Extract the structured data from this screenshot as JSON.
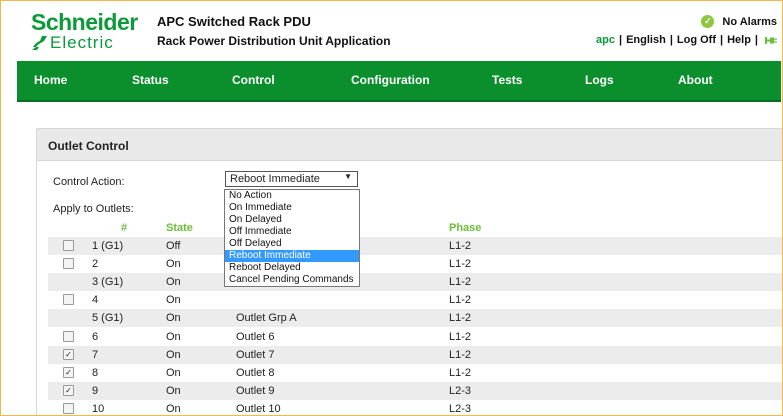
{
  "header": {
    "logo_top": "Schneider",
    "logo_bottom": "Electric",
    "title": "APC Switched Rack PDU",
    "subtitle": "Rack Power Distribution Unit Application",
    "alarm_status": "No Alarms",
    "user": "apc",
    "links": [
      "English",
      "Log Off",
      "Help"
    ],
    "separator": "|"
  },
  "nav": [
    "Home",
    "Status",
    "Control",
    "Configuration",
    "Tests",
    "Logs",
    "About"
  ],
  "panel": {
    "title": "Outlet Control",
    "control_action_label": "Control Action:",
    "apply_label": "Apply to Outlets:",
    "selected_action": "Reboot Immediate",
    "arrow": "▼"
  },
  "dropdown": {
    "options": [
      "No Action",
      "On Immediate",
      "On Delayed",
      "Off Immediate",
      "Off Delayed",
      "Reboot Immediate",
      "Reboot Delayed",
      "Cancel Pending Commands"
    ],
    "selected_index": 5
  },
  "table": {
    "headers": [
      "#",
      "State",
      "Phase"
    ],
    "rows": [
      {
        "num": "1 (G1)",
        "state": "Off",
        "name": "",
        "phase": "L1-2",
        "checkbox": true,
        "checked": false
      },
      {
        "num": "2",
        "state": "On",
        "name": "",
        "phase": "L1-2",
        "checkbox": true,
        "checked": false
      },
      {
        "num": "3 (G1)",
        "state": "On",
        "name": "",
        "phase": "L1-2",
        "checkbox": false,
        "checked": false
      },
      {
        "num": "4",
        "state": "On",
        "name": "",
        "phase": "L1-2",
        "checkbox": true,
        "checked": false
      },
      {
        "num": "5 (G1)",
        "state": "On",
        "name": "Outlet Grp A",
        "phase": "L1-2",
        "checkbox": false,
        "checked": false
      },
      {
        "num": "6",
        "state": "On",
        "name": "Outlet 6",
        "phase": "L1-2",
        "checkbox": true,
        "checked": false
      },
      {
        "num": "7",
        "state": "On",
        "name": "Outlet 7",
        "phase": "L1-2",
        "checkbox": true,
        "checked": true
      },
      {
        "num": "8",
        "state": "On",
        "name": "Outlet 8",
        "phase": "L1-2",
        "checkbox": true,
        "checked": true
      },
      {
        "num": "9",
        "state": "On",
        "name": "Outlet 9",
        "phase": "L2-3",
        "checkbox": true,
        "checked": true
      },
      {
        "num": "10",
        "state": "On",
        "name": "Outlet 10",
        "phase": "L2-3",
        "checkbox": true,
        "checked": false
      }
    ]
  },
  "colors": {
    "brand_green": "#0a9a3a",
    "nav_green": "#0a8f2c",
    "header_green_text": "#6abf3a",
    "selection_blue": "#3399ff"
  },
  "icons": {
    "alarm": "check-circle-icon",
    "logout": "plug-icon",
    "logo": "schneider-electric-logo"
  }
}
